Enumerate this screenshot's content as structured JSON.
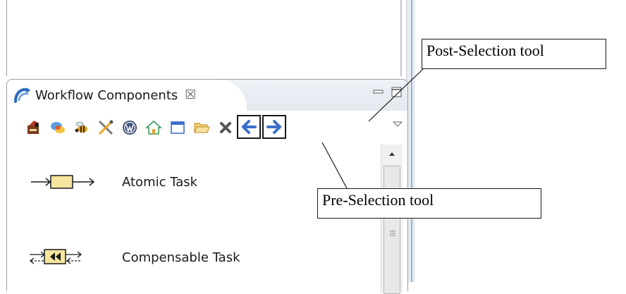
{
  "view": {
    "tab_label": "Workflow Components",
    "tab_close_glyph": "☒"
  },
  "toolbar": {
    "buttons": [
      {
        "icon": "bug-task-icon"
      },
      {
        "icon": "chat-bubbles-icon"
      },
      {
        "icon": "bee-icon"
      },
      {
        "icon": "tools-icon"
      },
      {
        "icon": "wordpress-icon"
      },
      {
        "icon": "home-icon"
      },
      {
        "icon": "window-icon"
      },
      {
        "icon": "folder-open-icon"
      },
      {
        "icon": "delete-icon"
      },
      {
        "icon": "arrow-left-icon"
      },
      {
        "icon": "arrow-right-icon"
      }
    ]
  },
  "palette": {
    "items": [
      {
        "label": "Atomic Task",
        "icon": "atomic-task-icon"
      },
      {
        "label": "Compensable Task",
        "icon": "compensable-task-icon"
      }
    ]
  },
  "callouts": {
    "post_selection": "Post-Selection tool",
    "pre_selection": "Pre-Selection tool"
  },
  "colors": {
    "arrow_blue": "#3b6fc9",
    "task_fill": "#f5e59f",
    "sash_accent": "#8fb3d9"
  }
}
